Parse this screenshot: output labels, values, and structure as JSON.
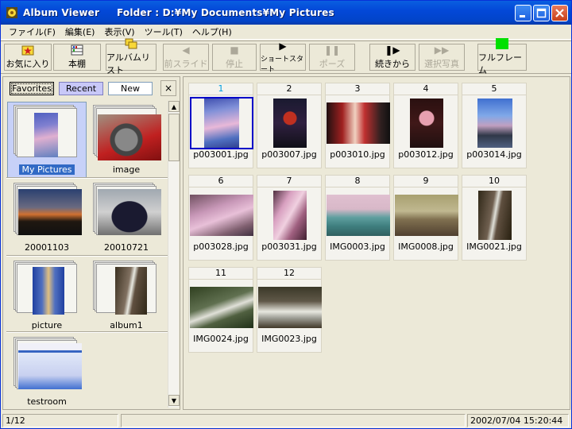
{
  "window": {
    "title": "Album Viewer     Folder : D:¥My Documents¥My Pictures"
  },
  "menu": [
    "ファイル(F)",
    "編集(E)",
    "表示(V)",
    "ツール(T)",
    "ヘルプ(H)"
  ],
  "toolbar": {
    "favorites": "お気に入り",
    "bookshelf": "本棚",
    "album_list": "アルバムリスト",
    "prev_slide": "前スライド",
    "stop": "停止",
    "short_start": "ショートスタート",
    "pause": "ポーズ",
    "continue": "続きから",
    "selected_photos": "選択写真",
    "fullframe": "フルフレーム"
  },
  "left": {
    "tabs": [
      "Favorites",
      "Recent",
      "New"
    ],
    "close": "×",
    "albums": [
      {
        "label": "My Pictures"
      },
      {
        "label": "image"
      },
      {
        "label": "20001103"
      },
      {
        "label": "20010721"
      },
      {
        "label": "picture"
      },
      {
        "label": "album1"
      },
      {
        "label": "testroom"
      }
    ]
  },
  "grid": [
    {
      "num": "1",
      "file": "p003001.jpg"
    },
    {
      "num": "2",
      "file": "p003007.jpg"
    },
    {
      "num": "3",
      "file": "p003010.jpg"
    },
    {
      "num": "4",
      "file": "p003012.jpg"
    },
    {
      "num": "5",
      "file": "p003014.jpg"
    },
    {
      "num": "6",
      "file": "p003028.jpg"
    },
    {
      "num": "7",
      "file": "p003031.jpg"
    },
    {
      "num": "8",
      "file": "IMG0003.jpg"
    },
    {
      "num": "9",
      "file": "IMG0008.jpg"
    },
    {
      "num": "10",
      "file": "IMG0021.jpg"
    },
    {
      "num": "11",
      "file": "IMG0024.jpg"
    },
    {
      "num": "12",
      "file": "IMG0023.jpg"
    }
  ],
  "status": {
    "count": "1/12",
    "datetime": "2002/07/04 15:20:44"
  },
  "colors": {
    "title_bar": "#0348d8",
    "selection": "#316ac5",
    "recent_tab": "#c8c8f8",
    "fullframe_icon": "#00e000"
  }
}
